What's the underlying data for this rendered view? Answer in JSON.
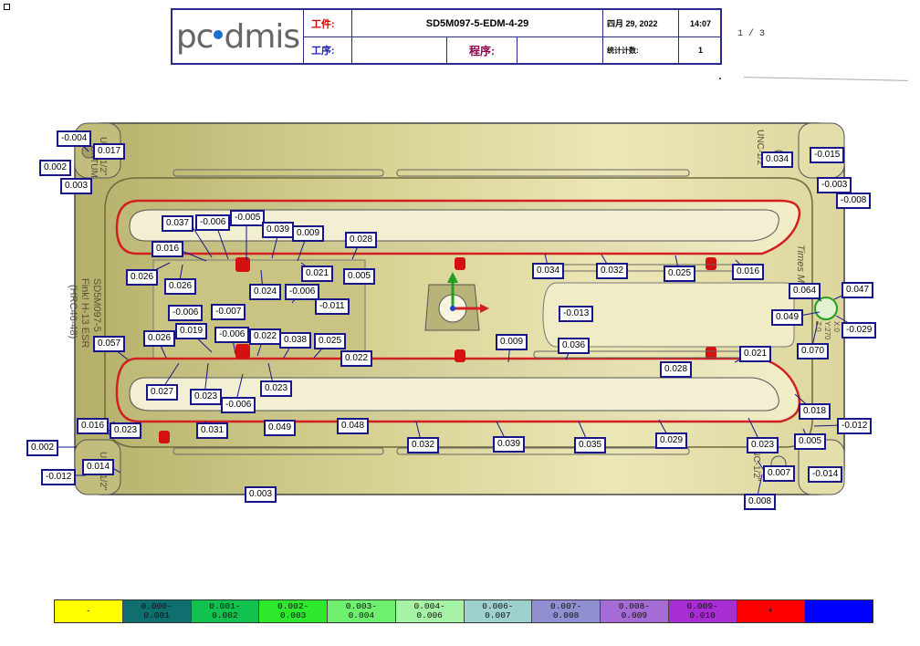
{
  "header": {
    "workpiece_label": "工件:",
    "part_name": "SD5M097-5-EDM-4-29",
    "date": "四月 29, 2022",
    "time": "14:07",
    "process_label": "工序:",
    "program_label": "程序:",
    "count_label": "统计计数:",
    "count_value": "1",
    "page_indicator": "1 / 3"
  },
  "part": {
    "engravings": [
      "UNC-1/2\"",
      "UNC-1/2\"",
      "UNC-1/2\"",
      "UNC-1/2\"",
      "DATUM",
      "SD5M097-5",
      "Fink! H-13 ESR",
      "(HRC46-48)",
      "Times Mod",
      "X:0",
      "Y:270",
      "Z:0"
    ],
    "deviations": [
      "-0.004",
      "0.017",
      "0.002",
      "0.003",
      "0.034",
      "-0.015",
      "-0.003",
      "-0.008",
      "0.037",
      "-0.006",
      "-0.005",
      "0.039",
      "0.009",
      "0.028",
      "0.016",
      "0.026",
      "0.026",
      "0.021",
      "0.005",
      "0.024",
      "-0.006",
      "-0.011",
      "0.034",
      "0.032",
      "0.025",
      "0.016",
      "0.064",
      "0.047",
      "0.049",
      "-0.029",
      "0.070",
      "-0.006",
      "-0.007",
      "-0.013",
      "0.019",
      "-0.006",
      "0.022",
      "0.038",
      "0.025",
      "0.022",
      "0.057",
      "0.026",
      "0.009",
      "0.036",
      "0.021",
      "0.028",
      "0.027",
      "0.023",
      "-0.006",
      "0.023",
      "0.018",
      "-0.012",
      "0.016",
      "0.023",
      "0.031",
      "0.049",
      "0.048",
      "0.032",
      "0.039",
      "0.035",
      "0.029",
      "0.023",
      "0.005",
      "0.002",
      "0.014",
      "-0.012",
      "0.007",
      "-0.014",
      "0.003",
      "0.008"
    ]
  },
  "legend": [
    {
      "label": "-",
      "color": "#ffff00"
    },
    {
      "label": "0.000-\n0.001",
      "color": "#0f6e6e"
    },
    {
      "label": "0.001-\n0.002",
      "color": "#12c24e"
    },
    {
      "label": "0.002-\n0.003",
      "color": "#2de82d"
    },
    {
      "label": "0.003-\n0.004",
      "color": "#6ef06e"
    },
    {
      "label": "0.004-\n0.006",
      "color": "#a6f2a6"
    },
    {
      "label": "0.006-\n0.007",
      "color": "#9ed0ce"
    },
    {
      "label": "0.007-\n0.008",
      "color": "#8f8fd2"
    },
    {
      "label": "0.008-\n0.009",
      "color": "#a46cd4"
    },
    {
      "label": "0.009-\n0.010",
      "color": "#a82ed4"
    },
    {
      "label": "+",
      "color": "#ff0000"
    },
    {
      "label": "",
      "color": "#0000ff"
    }
  ]
}
